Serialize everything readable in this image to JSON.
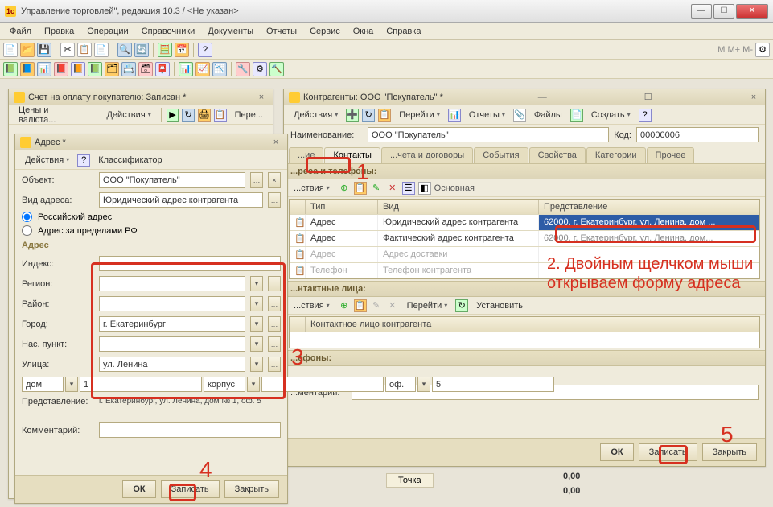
{
  "window": {
    "title": "Управление торговлей\", редакция 10.3 / <Не указан>"
  },
  "menu": [
    "Файл",
    "Правка",
    "Операции",
    "Справочники",
    "Документы",
    "Отчеты",
    "Сервис",
    "Окна",
    "Справка"
  ],
  "invoice_panel": {
    "title": "Счет на оплату покупателю: Записан *",
    "prices_btn": "Цены и валюта...",
    "actions_btn": "Действия",
    "go_btn": "Пере..."
  },
  "address_dialog": {
    "title": "Адрес *",
    "actions": "Действия",
    "classifier": "Классификатор",
    "object_lbl": "Объект:",
    "object_val": "ООО \"Покупатель\"",
    "type_lbl": "Вид адреса:",
    "type_val": "Юридический адрес контрагента",
    "radio_ru": "Российский адрес",
    "radio_foreign": "Адрес за пределами РФ",
    "section_addr": "Адрес",
    "index_lbl": "Индекс:",
    "index_val": "",
    "region_lbl": "Регион:",
    "region_val": "",
    "district_lbl": "Район:",
    "district_val": "",
    "city_lbl": "Город:",
    "city_val": "г. Екатеринбург",
    "town_lbl": "Нас. пункт:",
    "town_val": "",
    "street_lbl": "Улица:",
    "street_val": "ул. Ленина",
    "house_type": "дом",
    "house_val": "1",
    "block_type": "корпус",
    "block_val": "",
    "office_type": "оф.",
    "office_val": "5",
    "repr_lbl": "Представление:",
    "repr_val": "г. Екатеринбург, ул. Ленина, дом № 1, оф. 5",
    "comment_lbl": "Комментарий:",
    "comment_val": "",
    "ok": "ОК",
    "save": "Записать",
    "close": "Закрыть"
  },
  "counterparty_panel": {
    "title": "Контрагенты: ООО \"Покупатель\" *",
    "actions": "Действия",
    "go": "Перейти",
    "reports": "Отчеты",
    "files": "Файлы",
    "create": "Создать",
    "name_lbl": "Наименование:",
    "name_val": "ООО \"Покупатель\"",
    "code_lbl": "Код:",
    "code_val": "00000006",
    "tabs": [
      "...ие",
      "Контакты",
      "...чета и договоры",
      "События",
      "Свойства",
      "Категории",
      "Прочее"
    ],
    "section_addr": "...реса и телефоны:",
    "grid_actions": "...ствия",
    "main_label": "Основная",
    "grid_cols": [
      "Тип",
      "Вид",
      "Представление"
    ],
    "grid_rows": [
      {
        "type": "Адрес",
        "kind": "Юридический адрес контрагента",
        "repr": "62000, г. Екатеринбург, ул. Ленина, дом ...",
        "sel": true
      },
      {
        "type": "Адрес",
        "kind": "Фактический адрес контрагента",
        "repr": "62000, г. Екатеринбург, ул. Ленина, дом...",
        "sel": false
      },
      {
        "type": "Адрес",
        "kind": "Адрес доставки",
        "repr": "",
        "sel": false
      },
      {
        "type": "Телефон",
        "kind": "Телефон контрагента",
        "repr": "",
        "sel": false
      }
    ],
    "contacts_section": "...нтактные лица:",
    "contacts_actions": "...ствия",
    "contacts_go": "Перейти",
    "contacts_set": "Установить",
    "contact_col": "Контактное лицо контрагента",
    "phones_section": "...ефоны:",
    "comment_lbl": "...ментарий:",
    "ok": "ОК",
    "save": "Записать",
    "close": "Закрыть"
  },
  "bottom": {
    "col1": "Точка",
    "zero": "0,00"
  },
  "annotations": {
    "n1": "1",
    "n2": "2. Двойным щелчком мыши открываем форму адреса",
    "n3": "3",
    "n4": "4",
    "n5": "5"
  }
}
